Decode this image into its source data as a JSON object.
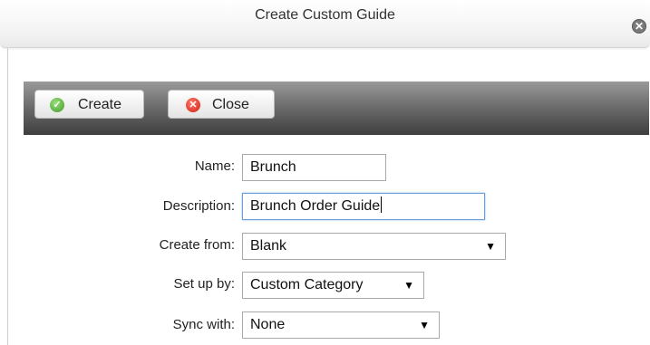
{
  "dialog": {
    "title": "Create Custom Guide",
    "close_icon": "close-circle-icon"
  },
  "toolbar": {
    "create_label": "Create",
    "create_icon": "check-circle-icon",
    "close_label": "Close",
    "close_icon": "x-circle-icon",
    "accent_create": "#3f9a2a",
    "accent_close": "#d11d12"
  },
  "form": {
    "name": {
      "label": "Name:",
      "value": "Brunch"
    },
    "description": {
      "label": "Description:",
      "value": "Brunch Order Guide"
    },
    "create_from": {
      "label": "Create from:",
      "value": "Blank"
    },
    "set_up_by": {
      "label": "Set up by:",
      "value": "Custom Category"
    },
    "sync_with": {
      "label": "Sync with:",
      "value": "None"
    }
  }
}
